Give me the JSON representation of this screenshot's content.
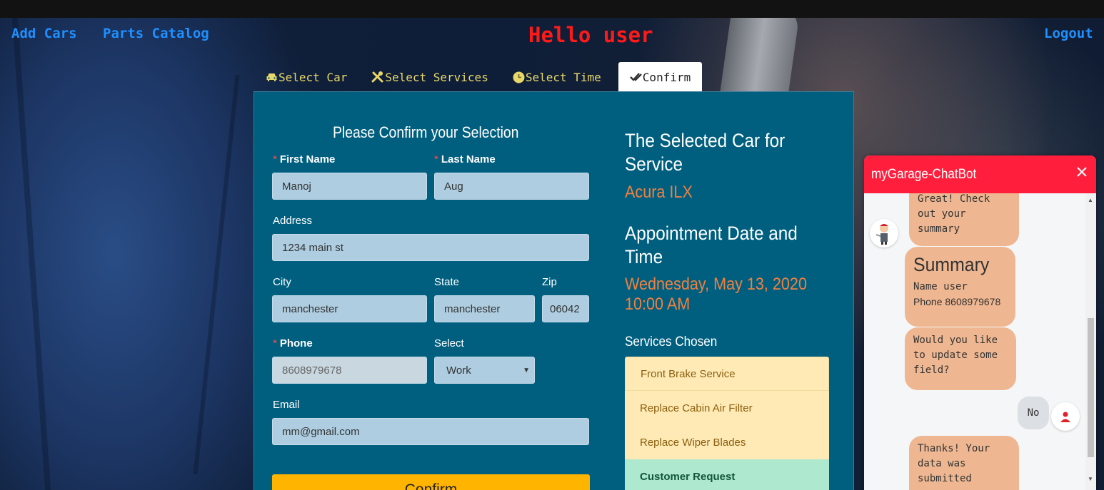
{
  "nav": {
    "add_cars": "Add Cars",
    "parts_catalog": "Parts Catalog",
    "greeting": "Hello user",
    "logout": "Logout"
  },
  "tabs": [
    {
      "label": "Select Car",
      "icon": "car-icon",
      "active": false
    },
    {
      "label": "Select Services",
      "icon": "tools-icon",
      "active": false
    },
    {
      "label": "Select Time",
      "icon": "clock-icon",
      "active": false
    },
    {
      "label": "Confirm",
      "icon": "check-double-icon",
      "active": true
    }
  ],
  "form": {
    "title": "Please Confirm your Selection",
    "first_name": {
      "label": "First Name",
      "value": "Manoj",
      "required": true
    },
    "last_name": {
      "label": "Last Name",
      "value": "Aug",
      "required": true
    },
    "address": {
      "label": "Address",
      "value": "1234 main st"
    },
    "city": {
      "label": "City",
      "value": "manchester"
    },
    "state": {
      "label": "State",
      "value": "manchester"
    },
    "zip": {
      "label": "Zip",
      "value": "06042"
    },
    "phone": {
      "label": "Phone",
      "value": "8608979678",
      "required": true
    },
    "phone_type": {
      "label": "Select",
      "value": "Work"
    },
    "email": {
      "label": "Email",
      "value": "mm@gmail.com"
    },
    "confirm_button": "Confirm"
  },
  "summary": {
    "car_heading_1": "The Selected Car for",
    "car_heading_2": "Service",
    "car": "Acura ILX",
    "time_heading_1": "Appointment Date and",
    "time_heading_2": "Time",
    "date": "Wednesday, May 13, 2020",
    "time": "10:00 AM",
    "services_heading": "Services Chosen",
    "services": [
      "Front Brake Service",
      "Replace Cabin Air Filter",
      "Replace Wiper Blades"
    ],
    "custom_request": "Customer Request"
  },
  "chat": {
    "title": "myGarage-ChatBot",
    "messages": {
      "m1_l1": "Great! Check",
      "m1_l2": "out your",
      "m1_l3": "summary",
      "summary_title": "Summary",
      "summary_name": "Name user",
      "summary_phone": "Phone 8608979678",
      "m3_l1": "Would you like",
      "m3_l2": "to update some",
      "m3_l3": "field?",
      "user_reply": "No",
      "m4_l1": "Thanks! Your",
      "m4_l2": "data was",
      "m4_l3": "submitted"
    }
  },
  "colors": {
    "nav_link": "#1e90ff",
    "greeting": "#ff1a1a",
    "panel": "#005f7f",
    "accent_orange": "#f08040",
    "confirm_button": "#ffb400",
    "chat_header": "#ff1f3d",
    "bot_bubble": "#efb791"
  }
}
